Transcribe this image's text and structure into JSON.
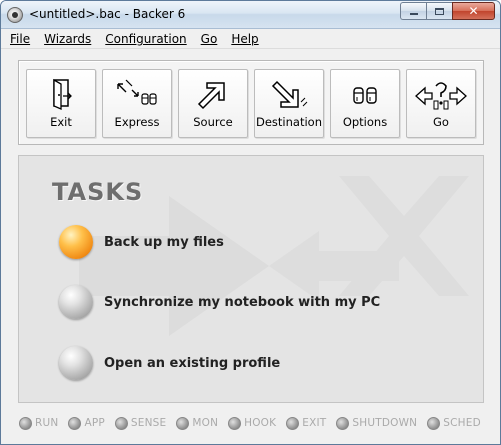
{
  "window": {
    "title": "<untitled>.bac - Backer 6",
    "close_glyph": "✕"
  },
  "menu": [
    {
      "label": "File"
    },
    {
      "label": "Wizards"
    },
    {
      "label": "Configuration"
    },
    {
      "label": "Go"
    },
    {
      "label": "Help"
    }
  ],
  "toolbar": {
    "exit": {
      "label": "Exit",
      "icon": "exit-door-icon"
    },
    "express": {
      "label": "Express",
      "icon": "express-icon"
    },
    "source": {
      "label": "Source",
      "icon": "source-arrow-icon"
    },
    "destination": {
      "label": "Destination",
      "icon": "destination-arrow-icon"
    },
    "options": {
      "label": "Options",
      "icon": "options-icon"
    },
    "go": {
      "label": "Go",
      "icon": "go-icon"
    }
  },
  "tasks": {
    "title": "TASKS",
    "items": [
      {
        "label": "Back up my files",
        "active": true
      },
      {
        "label": "Synchronize my notebook with my PC",
        "active": false
      },
      {
        "label": "Open an existing profile",
        "active": false
      }
    ]
  },
  "status": [
    {
      "label": "RUN"
    },
    {
      "label": "APP"
    },
    {
      "label": "SENSE"
    },
    {
      "label": "MON"
    },
    {
      "label": "HOOK"
    },
    {
      "label": "EXIT"
    },
    {
      "label": "SHUTDOWN"
    },
    {
      "label": "SCHED"
    }
  ],
  "colors": {
    "active_orb": "#f08a14",
    "tasks_title": "#6e6e6e",
    "status_text": "#aaaaaa"
  }
}
